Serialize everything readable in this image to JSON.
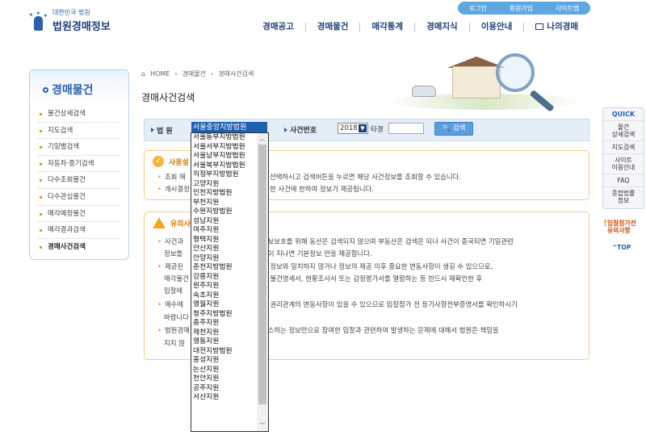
{
  "header": {
    "logo_small": "대한민국 법원",
    "logo_title": "법원경매정보",
    "top_links": [
      "로그인",
      "회원가입",
      "사이트맵"
    ],
    "gnb": [
      "경매공고",
      "경매물건",
      "매각통계",
      "경매지식",
      "이용안내",
      "나의경매"
    ]
  },
  "sidebar": {
    "title": "경매물건",
    "items": [
      "물건상세검색",
      "지도검색",
      "기일별검색",
      "자동차·중기검색",
      "다수조회물건",
      "다수관심물건",
      "매각예정물건",
      "매각결과검색",
      "경매사건검색"
    ],
    "active_index": 8
  },
  "breadcrumb": [
    "HOME",
    "경매물건",
    "경매사건검색"
  ],
  "page_title": "경매사건검색",
  "search": {
    "court_label": "법 원",
    "court_selected": "서울중앙지방법원",
    "case_label": "사건번호",
    "year": "2018",
    "type_label": "타경",
    "button": "검색"
  },
  "usage": {
    "title": "사용설",
    "lines": [
      "조회 매",
      "선택하시고 검색버튼을 누르면 해당 사건정보를 조회할 수 있습니다.",
      "개시결정",
      "한 사건에 한하여 정보가 제공됩니다."
    ]
  },
  "notice": {
    "title": "유의사",
    "lines": [
      "사건과",
      "정보보호를 위해 동산은 검색되지 않으며 부동산은 검색은 되나 사건이 종국되면 기일관련",
      "정보를",
      "일이 지나면 기본정보 만을 제공합니다.",
      "제공된",
      "된 정보와 일치하지 않거나 정보의 제공 이후 중요한 변동사항이 생길 수 있으므로,",
      "매각물건",
      "된 물건명세서, 현황조사서 또는 감정평가서를 열람하는 등 반드시 재확인한 후",
      "입찰에",
      "매수에",
      "한 권리관계의 변동사항이 있을 수 있으므로 입찰참가 전 등기사항전부증명서를 확인하시기",
      "바랍니다",
      "법원경매",
      "비스하는 정보만으로 참여한 입찰과 관련하여 발생하는 문제에 대해서 법원은 책임을",
      "지지 않"
    ]
  },
  "court_options": [
    "서울동부지방법원",
    "서울서부지방법원",
    "서울남부지방법원",
    "서울북부지방법원",
    "의정부지방법원",
    "고양지원",
    "인천지방법원",
    "부천지원",
    "수원지방법원",
    "성남지원",
    "여주지원",
    "평택지원",
    "안산지원",
    "안양지원",
    "춘천지방법원",
    "강릉지원",
    "원주지원",
    "속초지원",
    "영월지원",
    "청주지방법원",
    "충주지원",
    "제천지원",
    "영동지원",
    "대전지방법원",
    "홍성지원",
    "논산지원",
    "천안지원",
    "공주지원",
    "서산지원"
  ],
  "quick": {
    "title": "QUICK",
    "items": [
      "물건\n상세검색",
      "지도검색",
      "사이트\n이용안내",
      "FAQ",
      "종합법률\n정보"
    ],
    "notice": "입찰참가전\n유의사항",
    "top": "TOP"
  },
  "colors": {
    "accent": "#2b5fa8",
    "selected": "#1e5fb0",
    "warning": "#e39b1b"
  }
}
